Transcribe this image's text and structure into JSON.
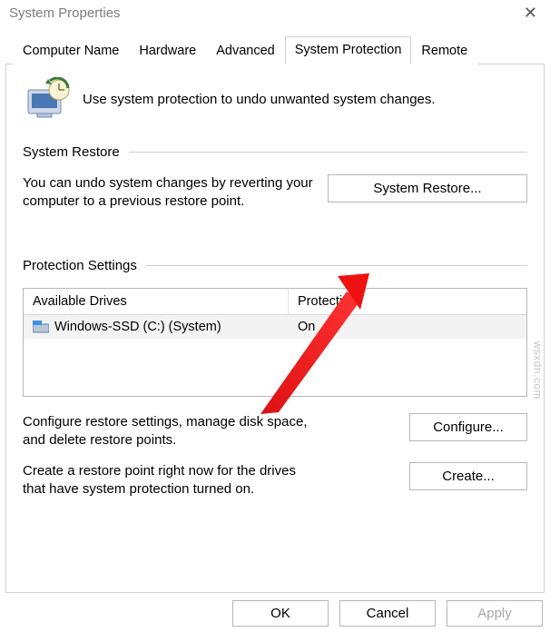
{
  "window": {
    "title": "System Properties"
  },
  "tabs": {
    "computer_name": "Computer Name",
    "hardware": "Hardware",
    "advanced": "Advanced",
    "system_protection": "System Protection",
    "remote": "Remote"
  },
  "intro": "Use system protection to undo unwanted system changes.",
  "system_restore": {
    "label": "System Restore",
    "text": "You can undo system changes by reverting your computer to a previous restore point.",
    "button": "System Restore..."
  },
  "protection_settings": {
    "label": "Protection Settings",
    "header_a": "Available Drives",
    "header_b": "Protection",
    "row_name": "Windows-SSD (C:) (System)",
    "row_status": "On",
    "configure_text": "Configure restore settings, manage disk space, and delete restore points.",
    "configure_button": "Configure...",
    "create_text": "Create a restore point right now for the drives that have system protection turned on.",
    "create_button": "Create..."
  },
  "footer": {
    "ok": "OK",
    "cancel": "Cancel",
    "apply": "Apply"
  },
  "watermark": "wsxdn.com"
}
